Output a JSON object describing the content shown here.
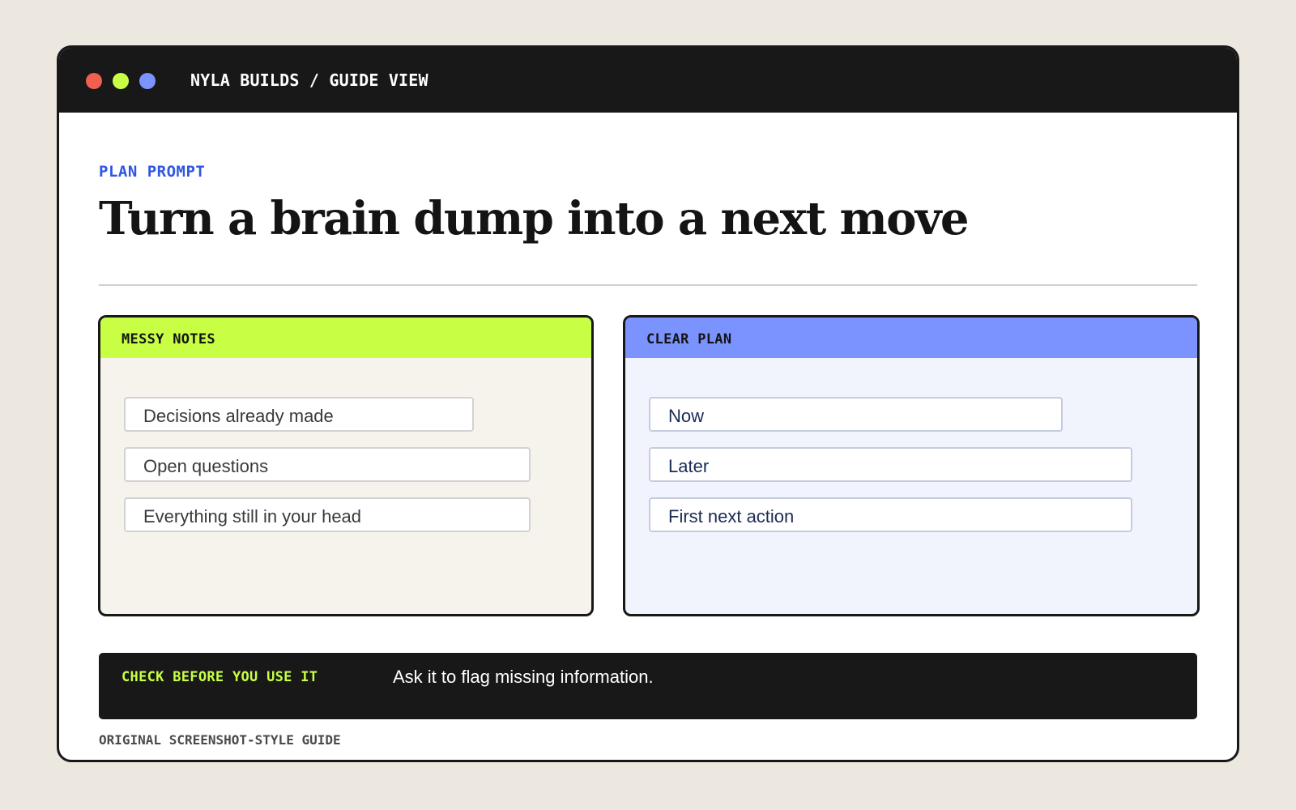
{
  "window": {
    "title": "NYLA BUILDS / GUIDE VIEW",
    "controls": {
      "close_color": "#f0604f",
      "minimize_color": "#c8ff45",
      "maximize_color": "#7b93ff"
    }
  },
  "main": {
    "eyebrow": "PLAN PROMPT",
    "headline": "Turn a brain dump into a next move"
  },
  "cards": {
    "messy": {
      "header": "MESSY NOTES",
      "accent": "#c8ff45",
      "items": [
        "Decisions already made",
        "Open questions",
        "Everything still in your head"
      ]
    },
    "clear": {
      "header": "CLEAR PLAN",
      "accent": "#7b93ff",
      "items": [
        "Now",
        "Later",
        "First next action"
      ]
    }
  },
  "tip": {
    "label": "CHECK BEFORE YOU USE IT",
    "text": "Ask it to flag missing information."
  },
  "footer": {
    "caption": "ORIGINAL SCREENSHOT-STYLE GUIDE"
  }
}
